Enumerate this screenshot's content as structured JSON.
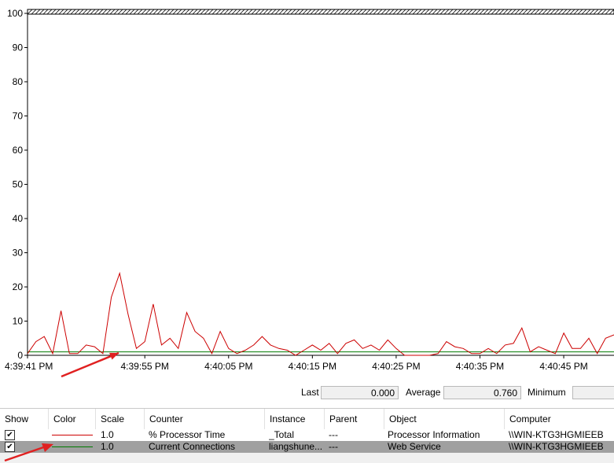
{
  "chart_data": {
    "type": "line",
    "ylim": [
      0,
      100
    ],
    "yticks": [
      0,
      10,
      20,
      30,
      40,
      50,
      60,
      70,
      80,
      90,
      100
    ],
    "xlim_seconds": [
      "4:39:41 PM",
      "4:40:52 PM"
    ],
    "xticks": [
      "4:39:41 PM",
      "4:39:55 PM",
      "4:40:05 PM",
      "4:40:15 PM",
      "4:40:25 PM",
      "4:40:35 PM",
      "4:40:45 PM"
    ],
    "grid": false,
    "series": [
      {
        "name": "% Processor Time",
        "color": "#cc0000",
        "values": [
          0.5,
          4,
          5.5,
          0.5,
          13,
          0.5,
          0.5,
          3,
          2.5,
          0.5,
          17,
          24,
          12,
          2,
          4,
          15,
          3,
          5,
          2,
          12.5,
          7,
          5,
          0.5,
          7,
          2,
          0.5,
          1.5,
          3,
          5.5,
          3,
          2,
          1.5,
          0,
          1.5,
          3,
          1.5,
          3.5,
          0.5,
          3.5,
          4.5,
          2,
          3,
          1.5,
          4.5,
          2,
          0,
          0,
          0,
          0,
          0.5,
          4,
          2.5,
          2,
          0.5,
          0.5,
          2,
          0.5,
          3,
          3.5,
          8,
          1,
          2.5,
          1.5,
          0.5,
          6.5,
          2,
          2,
          5,
          0.5,
          5,
          6
        ]
      },
      {
        "name": "Current Connections",
        "color": "#007a00",
        "values": [
          1,
          1,
          1,
          1,
          1,
          1,
          1,
          1,
          1,
          1,
          1,
          1,
          1,
          1,
          1,
          1,
          1,
          1,
          1,
          1,
          1,
          1,
          1,
          1,
          1,
          1,
          1,
          1,
          1,
          1,
          1,
          1,
          1,
          1,
          1,
          1,
          1,
          1,
          1,
          1,
          1,
          1,
          1,
          1,
          1,
          1,
          1,
          1,
          1,
          1,
          1,
          1,
          1,
          1,
          1,
          1,
          1,
          1,
          1,
          1,
          1,
          1,
          1,
          1,
          1,
          1,
          1,
          1,
          1,
          1,
          1
        ]
      }
    ],
    "annotation_color": "#e02020"
  },
  "stats": {
    "last_label": "Last",
    "last_value": "0.000",
    "average_label": "Average",
    "average_value": "0.760",
    "minimum_label": "Minimum",
    "minimum_value": ""
  },
  "legend": {
    "headers": [
      "Show",
      "Color",
      "Scale",
      "Counter",
      "Instance",
      "Parent",
      "Object",
      "Computer"
    ],
    "rows": [
      {
        "show": "✔",
        "color": "#cc0000",
        "scale": "1.0",
        "counter": "% Processor Time",
        "instance": "_Total",
        "parent": "---",
        "object": "Processor Information",
        "computer": "\\\\WIN-KTG3HGMIEEB"
      },
      {
        "show": "✔",
        "color": "#007a00",
        "scale": "1.0",
        "counter": "Current Connections",
        "instance": "liangshune...",
        "parent": "---",
        "object": "Web Service",
        "computer": "\\\\WIN-KTG3HGMIEEB"
      }
    ]
  }
}
